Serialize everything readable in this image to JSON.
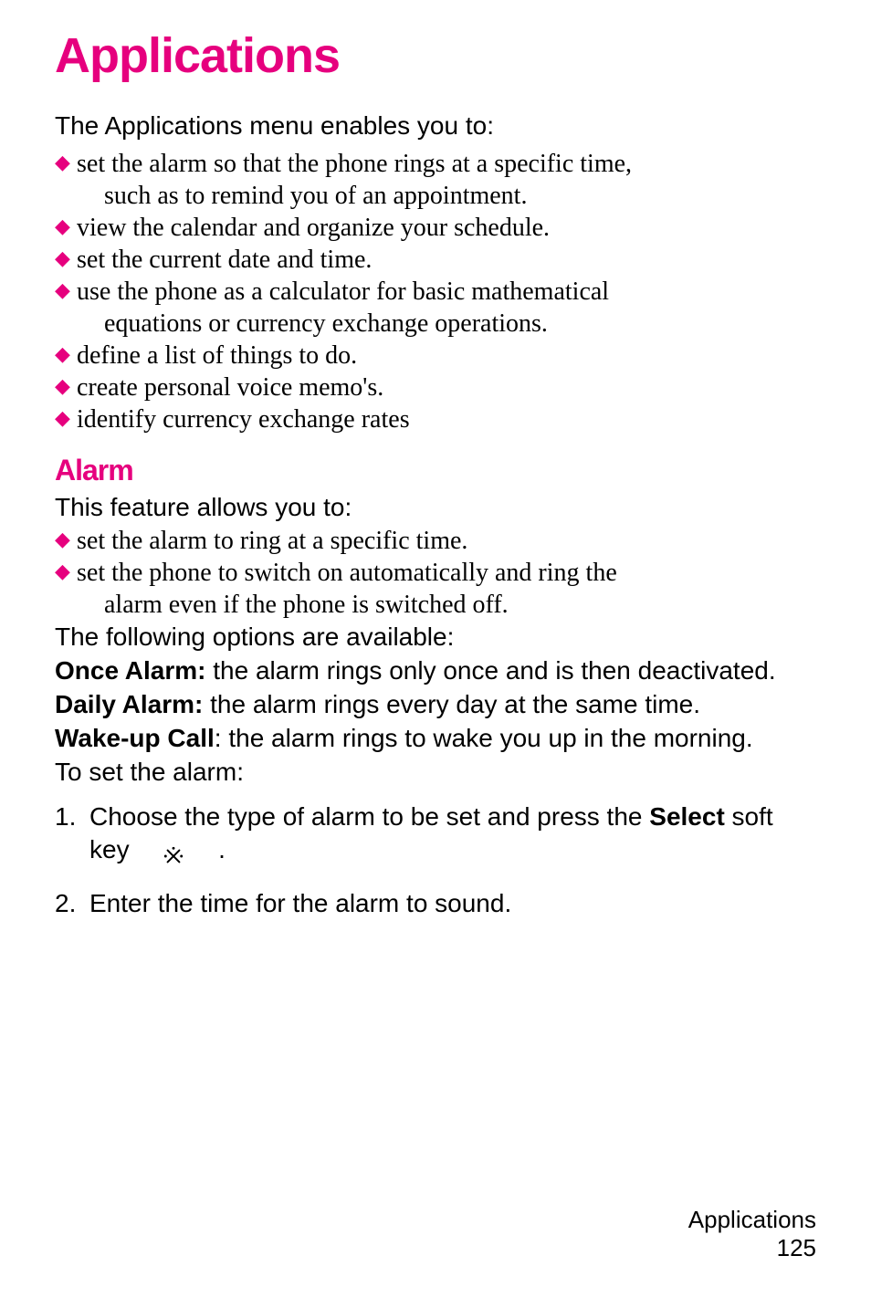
{
  "title": "Applications",
  "intro": "The Applications menu enables you to:",
  "bullets1": [
    {
      "first": "set the alarm so that the phone rings at a specific time,",
      "cont": "such as to remind you of an appointment."
    },
    {
      "first": "view the calendar and organize your schedule."
    },
    {
      "first": "set the current date and time."
    },
    {
      "first": "use the phone as a calculator for basic mathematical",
      "cont": "equations or currency exchange operations."
    },
    {
      "first": "define a list of things to do."
    },
    {
      "first": "create personal voice memo's."
    },
    {
      "first": "identify currency exchange rates"
    }
  ],
  "alarm": {
    "heading": "Alarm",
    "intro": "This feature allows you to:",
    "bullets": [
      {
        "first": "set the alarm to ring at a specific time."
      },
      {
        "first": "set the phone to switch on automatically and ring the",
        "cont": "alarm even if the phone is switched off."
      }
    ],
    "options_intro": "The following options are available:",
    "once_label": "Once Alarm: ",
    "once_text": "the alarm rings only once and is then deactivated.",
    "daily_label": "Daily Alarm: ",
    "daily_text": "the alarm rings every day at the same time.",
    "wakeup_label": "Wake-up Call",
    "wakeup_text": ": the alarm rings to wake you up in the morning.",
    "to_set": "To set the alarm:",
    "steps": {
      "s1_num": "1.",
      "s1_a": "Choose the type of alarm to be set and press the ",
      "s1_bold": "Select",
      "s1_b": " soft key ",
      "s1_c": ".",
      "s2_num": "2.",
      "s2": "Enter the time for the alarm to sound."
    }
  },
  "footer": {
    "section": "Applications",
    "page": "125"
  }
}
